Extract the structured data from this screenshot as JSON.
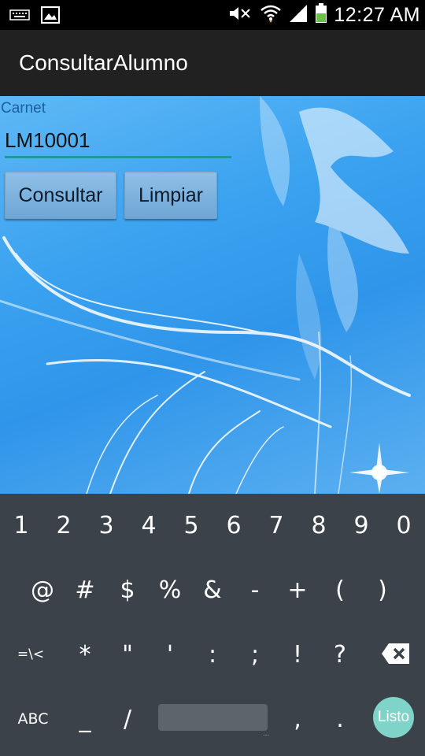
{
  "status_bar": {
    "time": "12:27 AM",
    "icons": [
      "keyboard-icon",
      "image-icon",
      "mute-icon",
      "wifi-icon",
      "signal-icon",
      "battery-icon"
    ]
  },
  "action_bar": {
    "title": "ConsultarAlumno"
  },
  "form": {
    "carnet_label": "Carnet",
    "carnet_value": "LM10001",
    "consultar_label": "Consultar",
    "limpiar_label": "Limpiar",
    "input_underline_color": "#1a9b9b"
  },
  "keyboard": {
    "row1": [
      "1",
      "2",
      "3",
      "4",
      "5",
      "6",
      "7",
      "8",
      "9",
      "0"
    ],
    "row2": [
      "@",
      "#",
      "$",
      "%",
      "&",
      "-",
      "+",
      "(",
      ")"
    ],
    "row3": [
      "=\\<",
      "*",
      "\"",
      "'",
      ":",
      ";",
      "!",
      "?"
    ],
    "abc_label": "ABC",
    "row4_keys": [
      "_",
      "/",
      ",",
      "."
    ],
    "space_dots": "...",
    "done_label": "Listo",
    "done_color": "#7fd3c8"
  }
}
